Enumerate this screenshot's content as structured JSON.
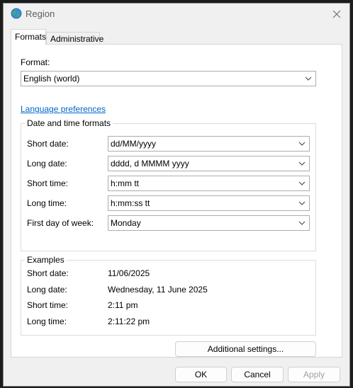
{
  "window": {
    "title": "Region"
  },
  "tabs": [
    {
      "label": "Formats"
    },
    {
      "label": "Administrative"
    }
  ],
  "format": {
    "label": "Format:",
    "value": "English (world)"
  },
  "links": {
    "language_preferences": "Language preferences"
  },
  "date_time": {
    "group_title": "Date and time formats",
    "rows": [
      {
        "label": "Short date:",
        "value": "dd/MM/yyyy"
      },
      {
        "label": "Long date:",
        "value": "dddd, d MMMM yyyy"
      },
      {
        "label": "Short time:",
        "value": "h:mm tt"
      },
      {
        "label": "Long time:",
        "value": "h:mm:ss tt"
      },
      {
        "label": "First day of week:",
        "value": "Monday"
      }
    ]
  },
  "examples": {
    "group_title": "Examples",
    "rows": [
      {
        "label": "Short date:",
        "value": "11/06/2025"
      },
      {
        "label": "Long date:",
        "value": "Wednesday, 11 June 2025"
      },
      {
        "label": "Short time:",
        "value": "2:11 pm"
      },
      {
        "label": "Long time:",
        "value": "2:11:22 pm"
      }
    ]
  },
  "buttons": {
    "additional_settings": "Additional settings...",
    "ok": "OK",
    "cancel": "Cancel",
    "apply": "Apply"
  },
  "icons": {
    "app": "globe-icon",
    "close": "close-icon",
    "dropdown": "chevron-down-icon"
  }
}
